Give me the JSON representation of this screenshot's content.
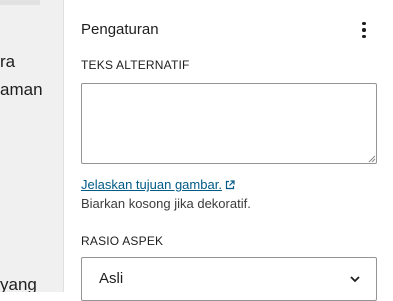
{
  "background_content": {
    "line_1": "ra",
    "line_2": "aman",
    "line_3": "yang"
  },
  "panel": {
    "title": "Pengaturan",
    "menu_icon": "more-vertical-icon",
    "alt_text": {
      "label": "TEKS ALTERNATIF",
      "value": "",
      "help_link": "Jelaskan tujuan gambar.",
      "help_link_icon": "external-link-icon",
      "help_text": "Biarkan kosong jika dekoratif."
    },
    "aspect_ratio": {
      "label": "RASIO ASPEK",
      "selected": "Asli",
      "icon": "chevron-down-icon"
    }
  },
  "colors": {
    "link": "#005a87",
    "text": "#1e1e1e",
    "border": "#949494",
    "left_background": "#f0f0f0"
  }
}
